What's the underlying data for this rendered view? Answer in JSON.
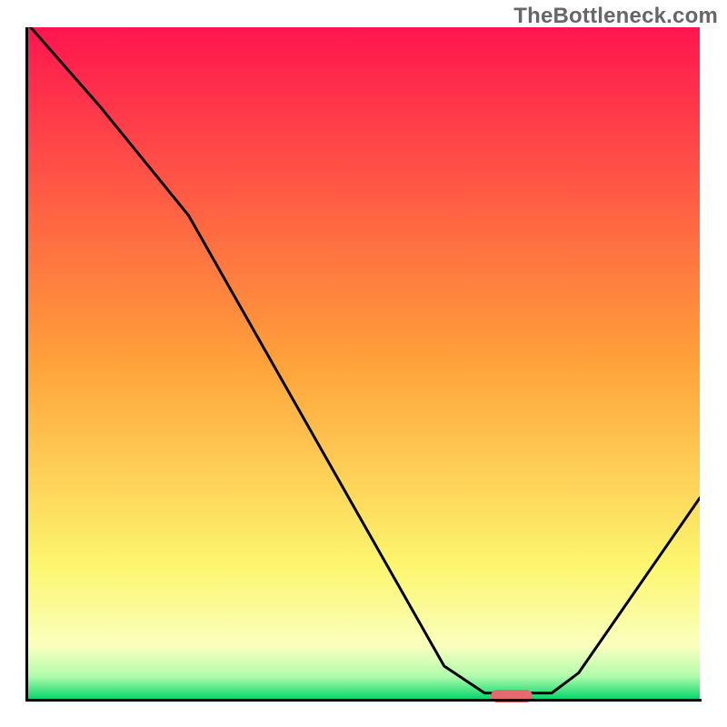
{
  "watermark": "TheBottleneck.com",
  "chart_data": {
    "type": "line",
    "title": "",
    "xlabel": "",
    "ylabel": "",
    "xlim": [
      0,
      100
    ],
    "ylim": [
      0,
      100
    ],
    "grid": false,
    "background_gradient": [
      {
        "stop": 0.0,
        "color": "#ff154f"
      },
      {
        "stop": 0.5,
        "color": "#ffa23a"
      },
      {
        "stop": 0.8,
        "color": "#fcf66e"
      },
      {
        "stop": 0.92,
        "color": "#faffbe"
      },
      {
        "stop": 0.965,
        "color": "#b1fcac"
      },
      {
        "stop": 1.0,
        "color": "#00d56a"
      }
    ],
    "series": [
      {
        "name": "bottleneck-curve",
        "color": "#000000",
        "x": [
          0.5,
          11,
          24,
          62,
          68,
          78,
          82,
          100
        ],
        "y": [
          100,
          88,
          72,
          5,
          1,
          1,
          4,
          30
        ]
      }
    ],
    "marker": {
      "name": "optimal-point",
      "color": "#e46a6f",
      "x": 72,
      "y": 0.5,
      "width_pct": 6.2,
      "height_pct": 1.9
    }
  }
}
